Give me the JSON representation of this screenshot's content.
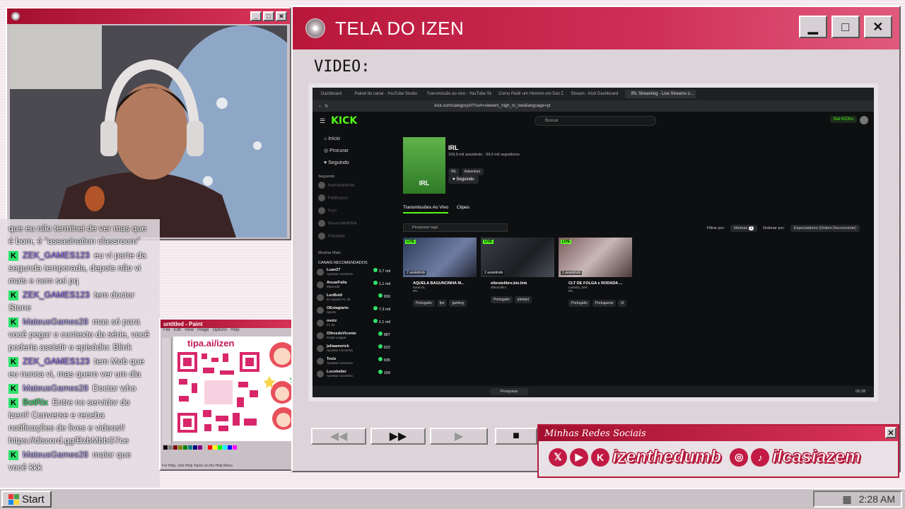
{
  "cam_window": {
    "title_icon": "disc-icon"
  },
  "main_window": {
    "title": "TELA DO IZEN",
    "video_label": "VIDEO:"
  },
  "browser": {
    "tabs": [
      "Dashboard",
      "Painel do canal - YouTube Studio",
      "Transmissão ao vivo - YouTube Studio",
      "Como Pedir um Homem em Dez D...",
      "Stream - Kick Dashboard",
      "IRL Streaming - Live Streams o..."
    ],
    "url": "kick.com/category/irl?sort=viewers_high_to_low&language=pt",
    "search_placeholder": "Buscar",
    "get_kick": "Get KICKs",
    "logo": "KICK",
    "nav": [
      "Início",
      "Procurar",
      "Seguindo"
    ],
    "following_heading": "Seguindo",
    "following": [
      "ilophobianikolai",
      "Pablitopzyo",
      "Pzyo",
      "RenanVAMPIRA",
      "Polinlatan"
    ],
    "show_more": "Mostrar Mais",
    "recommended_heading": "CANAIS RECOMENDADOS",
    "recommended": [
      {
        "name": "Luan27",
        "game": "Apostas Conversa",
        "viewers": "3,7 mil"
      },
      {
        "name": "AnuarFalla",
        "game": "Minecraft",
        "viewers": "1,1 mil"
      },
      {
        "name": "LeoBold",
        "game": "EA Sports FC 26",
        "viewers": "650"
      },
      {
        "name": "OEstagiario",
        "game": "Sports",
        "viewers": "7,3 mil"
      },
      {
        "name": "ovotz",
        "game": "F1 25",
        "viewers": "2,1 mil"
      },
      {
        "name": "OlhosdoVicente",
        "game": "Kings League",
        "viewers": "887"
      },
      {
        "name": "juliaamerick",
        "game": "Apostas Conversa",
        "viewers": "622"
      },
      {
        "name": "Teslz",
        "game": "Apostas Conversa",
        "viewers": "605"
      },
      {
        "name": "Locobelter",
        "game": "Apostas Conversa",
        "viewers": "169"
      }
    ],
    "category": {
      "image_label": "IRL",
      "name": "IRL",
      "stats": "109,9 mil assistindo · 59,6 mil seguidores",
      "tags": [
        "IRL",
        "Adventure"
      ],
      "follow_button": "Seguindo"
    },
    "subtabs": [
      "Transmissões Ao Vivo",
      "Clipes"
    ],
    "tag_search": "Pesquisar tags",
    "filter_label": "Filtrar por:",
    "filter_value": "Idiomas",
    "filter_count": "1",
    "sort_label": "Ordenar por:",
    "sort_value": "Espectadores (Ordem Decrescente)",
    "streams": [
      {
        "title": "AQUELA BAGUNCINHA M...",
        "channel": "KaoiLOL",
        "category": "IRL",
        "viewers": "2 assistindo",
        "live": "LIVE",
        "tags": [
          "Português",
          "fps",
          "gaming"
        ]
      },
      {
        "title": "elbrutolibro.bio.link",
        "channel": "elbrutolibro",
        "category": "",
        "viewers": "2 assistindo",
        "live": "LIVE",
        "tags": [
          "Português",
          "pleidart"
        ]
      },
      {
        "title": "CLT DE FOLGA e RODADA ...",
        "channel": "Leandro_Bell",
        "category": "IRL",
        "viewers": "1 assistindo",
        "live": "LIVE",
        "tags": [
          "Português",
          "Portuguese",
          "irl"
        ]
      }
    ],
    "taskbar_search": "Pesquisar",
    "taskbar_clock": "02:28"
  },
  "chat": [
    {
      "user": "",
      "text": "que eu não terminei de ver mas que é bom, é \"assasination classroom\"",
      "user_color": "purple"
    },
    {
      "user": "ZEK_GAMES123",
      "text": "eu vi parte da segunda temporada, depois não vi mais e nem sei pq",
      "user_color": "purple"
    },
    {
      "user": "ZEK_GAMES123",
      "text": "tem doctor Stone",
      "user_color": "purple"
    },
    {
      "user": "MateusGames28",
      "text": "mas só para você pegar o contexto da série, você poderia assistir o episódio: Blink",
      "user_color": "lavender"
    },
    {
      "user": "ZEK_GAMES123",
      "text": "tem Mob que eu nunca vi, mas quero ver um dia",
      "user_color": "purple"
    },
    {
      "user": "MateusGames28",
      "text": "Doctor who",
      "user_color": "lavender"
    },
    {
      "user": "BotRix",
      "text": "Entre no servidor do izen!! Converse e receba notificações de lives e videos!! https://discord.gg/BzbMbbG7ce",
      "user_color": "green"
    },
    {
      "user": "MateusGames28",
      "text": "maior que você kkk",
      "user_color": "lavender"
    }
  ],
  "paint": {
    "title": "untitled - Paint",
    "menu": [
      "File",
      "Edit",
      "View",
      "Image",
      "Options",
      "Help"
    ],
    "tip_url": "tipa.ai/izen",
    "status": "For Help, click Help Topics on the Help Menu."
  },
  "social": {
    "title": "Minhas Redes Sociais",
    "handle1": "izenthedumb",
    "handle2": "ilcasiazem",
    "icons": [
      "x-icon",
      "youtube-icon",
      "kick-icon",
      "instagram-icon",
      "tiktok-icon"
    ]
  },
  "start": {
    "label": "Start",
    "clock": "2:28 AM"
  },
  "colors": {
    "accent": "#b8173a",
    "kick_green": "#53fc18"
  }
}
